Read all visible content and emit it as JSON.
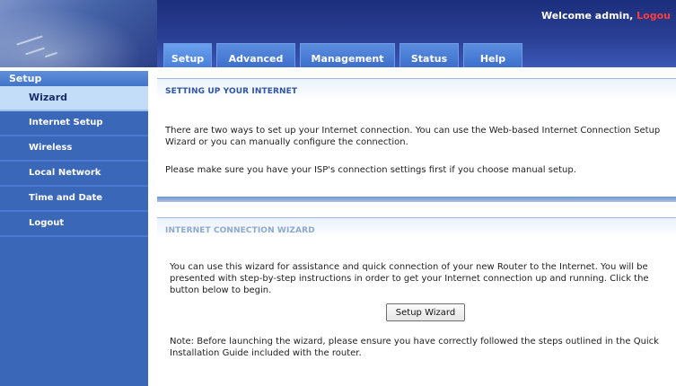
{
  "header": {
    "welcome_text": "Welcome admin, ",
    "logout_link": "Logou"
  },
  "tabs": [
    {
      "label": "Setup",
      "active": true
    },
    {
      "label": "Advanced",
      "active": false
    },
    {
      "label": "Management",
      "active": false
    },
    {
      "label": "Status",
      "active": false
    },
    {
      "label": "Help",
      "active": false
    }
  ],
  "sidebar": {
    "title": "Setup",
    "items": [
      {
        "label": "Wizard",
        "active": true
      },
      {
        "label": "Internet Setup",
        "active": false
      },
      {
        "label": "Wireless",
        "active": false
      },
      {
        "label": "Local Network",
        "active": false
      },
      {
        "label": "Time and Date",
        "active": false
      },
      {
        "label": "Logout",
        "active": false
      }
    ]
  },
  "main": {
    "section1_title": "SETTING UP YOUR INTERNET",
    "para1": "There are two ways to set up your Internet connection. You can use the Web-based Internet Connection Setup Wizard or you can manually configure the connection.",
    "para2": "Please make sure you have your ISP's connection settings first if you choose manual setup.",
    "section2_title": "INTERNET CONNECTION WIZARD",
    "para3": "You can use this wizard for assistance and quick connection of your new Router to the Internet. You will be presented with step-by-step instructions in order to get your Internet connection up and running. Click the button below to begin.",
    "wizard_button": "Setup Wizard",
    "note": "Note: Before launching the wizard, please ensure you have correctly followed the steps outlined in the Quick Installation Guide included with the router."
  },
  "colors": {
    "header_bg": "#2a3f94",
    "tab_bg": "#3d6fcc",
    "sidebar_bg": "#3a67b7",
    "sidebar_active_bg": "#c3dcf7",
    "section_title": "#2f55a4",
    "logout_link": "#ff3b3b"
  }
}
